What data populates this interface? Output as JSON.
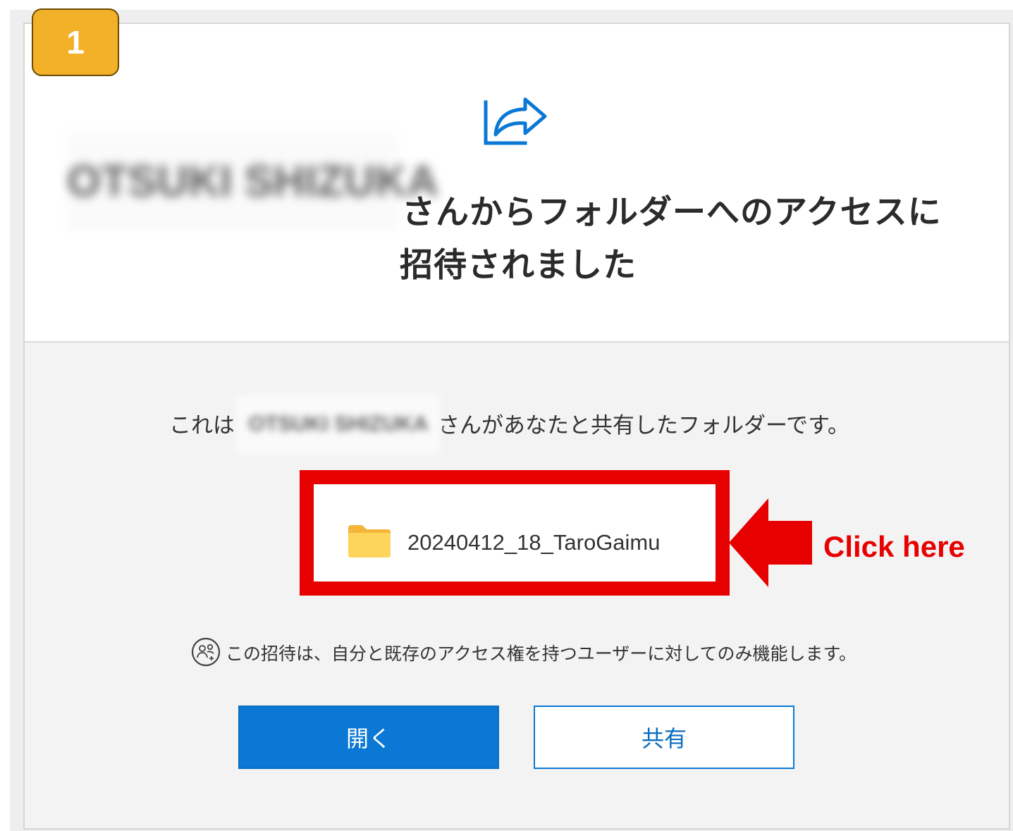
{
  "step": {
    "number": "1"
  },
  "header": {
    "sender_name_blurred": "OTSUKI SHIZUKA",
    "title_line1": "さんからフォルダーへのアクセスに",
    "title_line2": "招待されました"
  },
  "body": {
    "desc_prefix": "これは",
    "desc_sender_blurred": "OTSUKI SHIZUKA",
    "desc_suffix": "さんがあなたと共有したフォルダーです。",
    "folder_name": "20240412_18_TaroGaimu",
    "annotation_label": "Click here",
    "notice": "この招待は、自分と既存のアクセス権を持つユーザーに対してのみ機能します。"
  },
  "buttons": {
    "open_label": "開く",
    "share_label": "共有"
  },
  "icons": {
    "header": "share-icon",
    "folder": "folder-icon",
    "notice": "people-icon",
    "annotation": "arrow-left-icon"
  },
  "colors": {
    "accent": "#0a78d4",
    "highlight": "#e60000",
    "badge": "#f3b12a",
    "folder": "#f8c84a"
  }
}
